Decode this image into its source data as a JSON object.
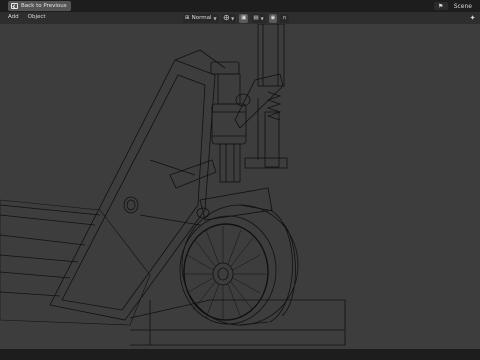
{
  "topbar": {
    "back_label": "Back to Previous",
    "scene_label": "Scene",
    "scene_icon": "scene-icon"
  },
  "header": {
    "menu": [
      "Add",
      "Object"
    ],
    "orientation_label": "Normal",
    "icons": [
      "transform-orientation-icon",
      "pivot-icon",
      "snap-icon",
      "proportional-edit-icon",
      "view-toggle-icon"
    ]
  },
  "viewport": {
    "mode": "wireframe",
    "object": "pallet jack wheel assembly"
  },
  "colors": {
    "topbar_bg": "#1d1d1d",
    "header_bg": "#2e2e2e",
    "viewport_bg": "#3d3d3d",
    "wire": "#111111"
  }
}
